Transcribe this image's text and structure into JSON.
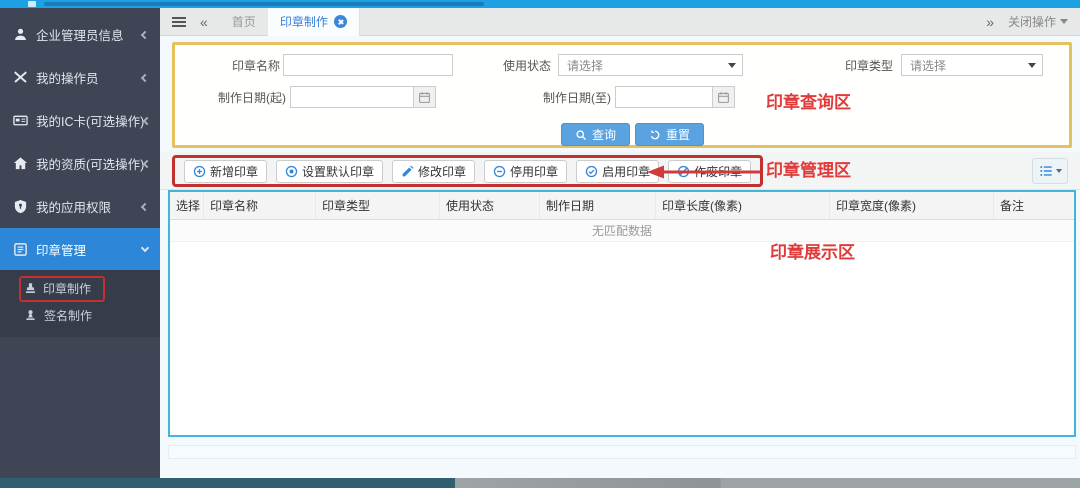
{
  "topbar": {
    "close_ops_label": "关闭操作"
  },
  "icons": {
    "collapse_left": "«",
    "expand_right": "»"
  },
  "tabs": {
    "home": "首页",
    "active": "印章制作"
  },
  "sidebar": {
    "items": [
      {
        "label": "企业管理员信息",
        "icon": "user-icon"
      },
      {
        "label": "我的操作员",
        "icon": "tools-icon"
      },
      {
        "label": "我的IC卡(可选操作)",
        "icon": "ic-card-icon"
      },
      {
        "label": "我的资质(可选操作)",
        "icon": "home-icon"
      },
      {
        "label": "我的应用权限",
        "icon": "shield-icon"
      },
      {
        "label": "印章管理",
        "icon": "seal-folder-icon"
      }
    ],
    "subitems": [
      {
        "label": "印章制作",
        "icon": "stamp-icon",
        "highlighted": true
      },
      {
        "label": "签名制作",
        "icon": "stamp-icon"
      }
    ]
  },
  "query": {
    "seal_name_label": "印章名称",
    "status_label": "使用状态",
    "type_label": "印章类型",
    "date_from_label": "制作日期(起)",
    "date_to_label": "制作日期(至)",
    "select_placeholder": "请选择",
    "search_btn": "查询",
    "reset_btn": "重置"
  },
  "toolbar": {
    "buttons": [
      {
        "label": "新增印章",
        "icon": "plus-circle-icon"
      },
      {
        "label": "设置默认印章",
        "icon": "default-circle-icon"
      },
      {
        "label": "修改印章",
        "icon": "pencil-icon"
      },
      {
        "label": "停用印章",
        "icon": "minus-circle-icon"
      },
      {
        "label": "启用印章",
        "icon": "check-circle-icon"
      },
      {
        "label": "作废印章",
        "icon": "void-circle-icon"
      }
    ]
  },
  "table": {
    "headers": [
      "选择",
      "印章名称",
      "印章类型",
      "使用状态",
      "制作日期",
      "印章长度(像素)",
      "印章宽度(像素)",
      "备注"
    ],
    "empty_text": "无匹配数据"
  },
  "annotations": {
    "query_area": "印章查询区",
    "manage_area": "印章管理区",
    "display_area": "印章展示区"
  },
  "colors": {
    "topbar_blue": "#1da1e4",
    "sidebar_dark": "#3f4554",
    "active_blue": "#2e86d8",
    "annotation_red": "#e03b3b",
    "query_border_yellow": "#e6c25e",
    "manage_border_red": "#c2312e",
    "table_border_cyan": "#43b5d8"
  }
}
